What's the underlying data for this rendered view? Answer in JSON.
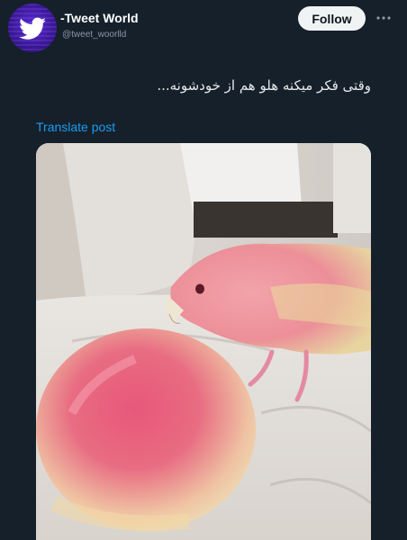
{
  "account": {
    "display_name": "-Tweet World",
    "handle": "@tweet_woorlld",
    "avatar_icon": "twitter-bird-icon"
  },
  "actions": {
    "follow_label": "Follow",
    "more_icon": "more-options-icon"
  },
  "post": {
    "text": "وقتی فکر میکنه هلو هم از خودشونه...",
    "translate_label": "Translate post"
  },
  "media": {
    "description_icon": "photo-media"
  },
  "colors": {
    "background": "#15202b",
    "link": "#1d9bf0",
    "follow_button_bg": "#eff3f4",
    "secondary_text": "#8b98a5"
  }
}
